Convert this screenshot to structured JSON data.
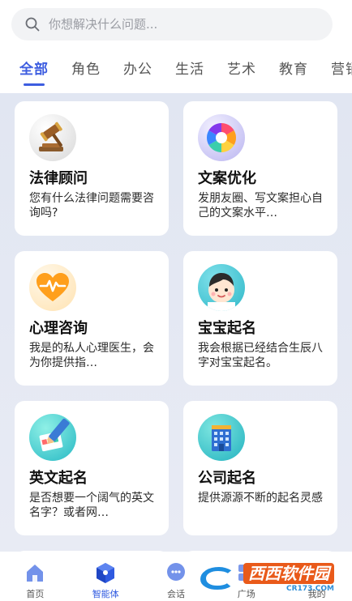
{
  "search": {
    "placeholder": "你想解决什么问题..."
  },
  "tabs": [
    {
      "label": "全部",
      "active": true
    },
    {
      "label": "角色"
    },
    {
      "label": "办公"
    },
    {
      "label": "生活"
    },
    {
      "label": "艺术"
    },
    {
      "label": "教育"
    },
    {
      "label": "营销"
    }
  ],
  "cards": [
    {
      "title": "法律顾问",
      "desc": "您有什么法律问题需要咨询吗?",
      "icon": "gavel-icon"
    },
    {
      "title": "文案优化",
      "desc": "发朋友圈、写文案担心自己的文案水平…",
      "icon": "color-wheel-icon"
    },
    {
      "title": "心理咨询",
      "desc": "我是的私人心理医生，会为你提供指…",
      "icon": "heart-pulse-icon"
    },
    {
      "title": "宝宝起名",
      "desc": "我会根据已经结合生辰八字对宝宝起名。",
      "icon": "baby-face-icon"
    },
    {
      "title": "英文起名",
      "desc": "是否想要一个阔气的英文名字？或者网…",
      "icon": "pen-swatch-icon"
    },
    {
      "title": "公司起名",
      "desc": "提供源源不断的起名灵感",
      "icon": "building-icon"
    }
  ],
  "bottom_nav": [
    {
      "label": "首页",
      "icon": "home-icon"
    },
    {
      "label": "智能体",
      "icon": "cube-icon",
      "active": true
    },
    {
      "label": "会话",
      "icon": "chat-icon"
    },
    {
      "label": "广场",
      "icon": "square-icon"
    },
    {
      "label": "我的",
      "icon": "user-icon"
    }
  ],
  "watermark": {
    "main": "西西软件园",
    "sub": "CR173.COM"
  },
  "colors": {
    "accent": "#3d5de0",
    "content_bg": "#e3e7f2"
  }
}
